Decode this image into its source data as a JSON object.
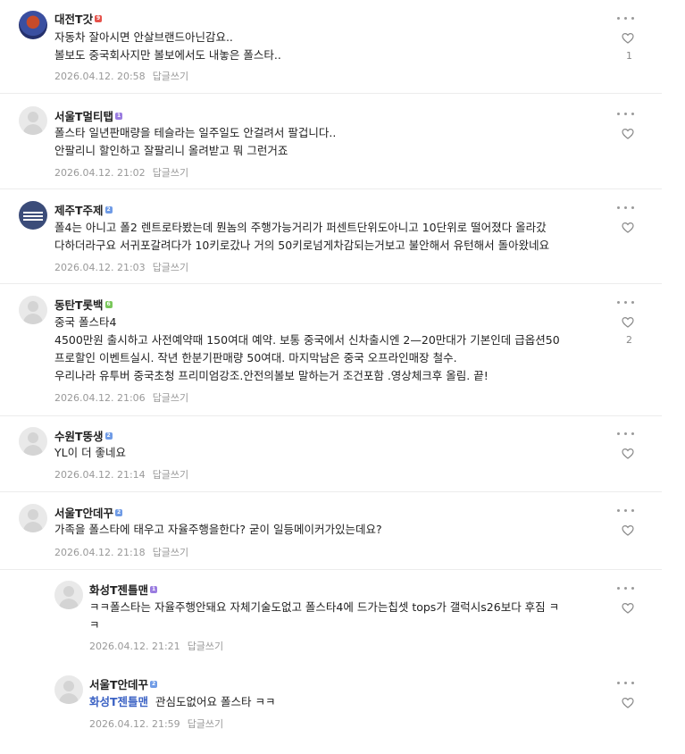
{
  "reply_label": "답글쓰기",
  "colors": {
    "lvl_red": "#e6524b",
    "lvl_purple": "#9a7ce0",
    "lvl_blue": "#6f9be6",
    "lvl_green": "#79c75a",
    "mention": "#3b62c4"
  },
  "comments": [
    {
      "nick": "대전T갓",
      "level": "9",
      "text": [
        "자동차 잘아시면 안살브랜드아닌감요..",
        "볼보도 중국회사지만 볼보에서도 내놓은 폴스타.."
      ],
      "date": "2026.04.12. 20:58",
      "likes": "1"
    },
    {
      "nick": "서울T멀티탭",
      "level": "1",
      "text": [
        "폴스타 일년판매량을 테슬라는 일주일도 안걸려서 팔겁니다..",
        "안팔리니 할인하고 잘팔리니 올려받고 뭐 그런거죠"
      ],
      "date": "2026.04.12. 21:02",
      "likes": ""
    },
    {
      "nick": "제주T주제",
      "level": "2",
      "text": [
        "폴4는 아니고 폴2 렌트로타봤는데 뭔놈의 주행가능거리가 퍼센트단위도아니고 10단위로 떨어졌다 올라갔",
        "다하더라구요 서귀포갈려다가 10키로갔나 거의 50키로넘게차감되는거보고 불안해서 유턴해서 돌아왔네요"
      ],
      "date": "2026.04.12. 21:03",
      "likes": ""
    },
    {
      "nick": "동탄T롯백",
      "level": "6",
      "text": [
        "중국 폴스타4",
        "4500만원 출시하고 사전예약때 150여대 예약. 보통 중국에서 신차출시엔 2—20만대가 기본인데 급옵션50",
        "프로할인 이벤트실시. 작년 한분기판매량 50여대. 마지막남은 중국 오프라인매장 철수.",
        "우리나라 유투버 중국초청 프리미엄강조.안전의볼보 말하는거 조건포함 .영상체크후 올림. 끝!"
      ],
      "date": "2026.04.12. 21:06",
      "likes": "2"
    },
    {
      "nick": "수원T뚱생",
      "level": "2",
      "text": [
        "YL이 더 좋네요"
      ],
      "date": "2026.04.12. 21:14",
      "likes": ""
    },
    {
      "nick": "서울T안데꾸",
      "level": "2",
      "text": [
        "가족을 폴스타에 태우고 자율주행을한다? 굳이 일등메이커가있는데요?"
      ],
      "date": "2026.04.12. 21:18",
      "likes": ""
    },
    {
      "nick": "화성T젠틀맨",
      "level": "1",
      "text": [
        "ㅋㅋ폴스타는 자율주행안돼요 자체기술도없고 폴스타4에 드가는칩셋 tops가 갤럭시s26보다 후짐 ㅋ",
        "ㅋ"
      ],
      "date": "2026.04.12. 21:21",
      "likes": ""
    },
    {
      "nick": "서울T안데꾸",
      "level": "2",
      "mention": "화성T젠틀맨",
      "text": [
        "관심도없어요 폴스타 ㅋㅋ"
      ],
      "date": "2026.04.12. 21:59",
      "likes": ""
    }
  ]
}
